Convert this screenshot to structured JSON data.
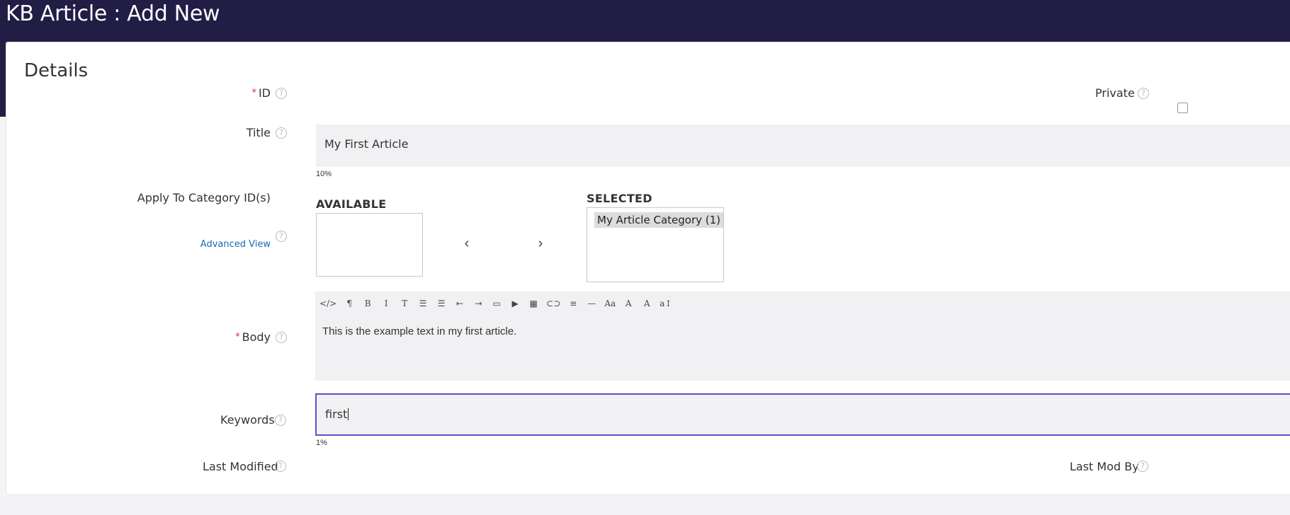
{
  "header": {
    "title": "KB Article : Add New"
  },
  "section": {
    "title": "Details"
  },
  "fields": {
    "id": {
      "label": "ID",
      "required": "*"
    },
    "private": {
      "label": "Private"
    },
    "title": {
      "label": "Title",
      "value": "My First Article",
      "percent": "10%"
    },
    "categories": {
      "label": "Apply To Category ID(s)",
      "advanced_link": "Advanced View",
      "available_heading": "AVAILABLE",
      "selected_heading": "SELECTED",
      "selected_items": [
        "My Article Category (1)"
      ],
      "move_left": "‹",
      "move_right": "›"
    },
    "body": {
      "label": "Body",
      "required": "*",
      "value": "This is the example text in my first article.",
      "toolbar": [
        "code-view-icon",
        "paragraph-icon",
        "bold-icon",
        "italic-icon",
        "strikethrough-icon",
        "bullet-list-icon",
        "numbered-list-icon",
        "outdent-icon",
        "indent-icon",
        "image-icon",
        "video-icon",
        "table-icon",
        "link-icon",
        "align-icon",
        "horizontal-rule-icon",
        "font-family-icon",
        "font-color-icon",
        "background-color-icon",
        "line-height-icon"
      ],
      "toolbar_glyphs": [
        "</>",
        "¶",
        "B",
        "I",
        "T",
        "☰",
        "☰",
        "⇤",
        "⇥",
        "▭",
        "▶",
        "▦",
        "⊂⊃",
        "≡",
        "—",
        "Aa",
        "A",
        "A",
        "a↕"
      ]
    },
    "keywords": {
      "label": "Keywords",
      "value": "first",
      "percent": "1%"
    },
    "last_modified": {
      "label": "Last Modified"
    },
    "last_mod_by": {
      "label": "Last Mod By"
    }
  },
  "help_glyph": "?",
  "colors": {
    "header_bg": "#211d45",
    "required": "#d9282f",
    "link": "#1b69b6",
    "focus_border": "#5b50c8"
  }
}
